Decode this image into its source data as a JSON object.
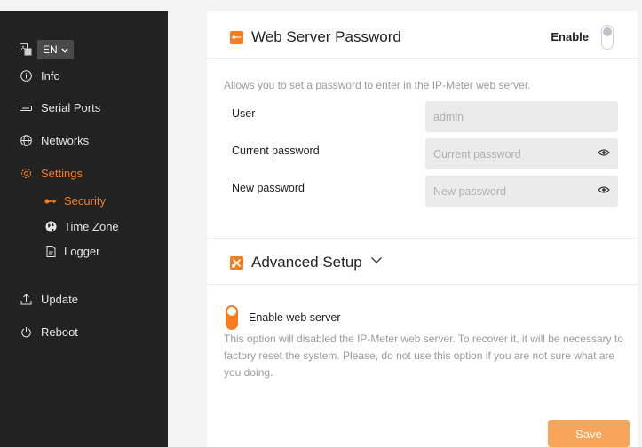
{
  "sidebar": {
    "language": "EN",
    "items": [
      {
        "label": "Info",
        "icon": "info-icon"
      },
      {
        "label": "Serial Ports",
        "icon": "serial-port-icon"
      },
      {
        "label": "Networks",
        "icon": "globe-icon"
      },
      {
        "label": "Settings",
        "icon": "gear-icon"
      },
      {
        "label": "Update",
        "icon": "upload-icon"
      },
      {
        "label": "Reboot",
        "icon": "power-icon"
      }
    ],
    "settings_subitems": [
      {
        "label": "Security",
        "icon": "key-icon"
      },
      {
        "label": "Time Zone",
        "icon": "globe-filled-icon"
      },
      {
        "label": "Logger",
        "icon": "document-icon"
      }
    ],
    "active_item": "Settings",
    "active_subitem": "Security"
  },
  "web_server_password": {
    "title": "Web Server Password",
    "enable_label": "Enable",
    "enable_on": false,
    "description": "Allows you to set a password to enter in the IP-Meter web server.",
    "fields": {
      "user": {
        "label": "User",
        "placeholder": "admin"
      },
      "current_password": {
        "label": "Current password",
        "placeholder": "Current password"
      },
      "new_password": {
        "label": "New password",
        "placeholder": "New password"
      }
    }
  },
  "advanced_setup": {
    "title": "Advanced Setup",
    "enable_web_server_label": "Enable web server",
    "enable_web_server_on": true,
    "warning": "This option will disabled the IP-Meter web server. To recover it, it will be necessary to factory reset the system. Please, do not use this option if you are not sure what are you doing."
  },
  "actions": {
    "save_label": "Save"
  },
  "colors": {
    "accent": "#f57c1f",
    "sidebar_bg": "#222222",
    "save_button": "#f6a55a"
  }
}
